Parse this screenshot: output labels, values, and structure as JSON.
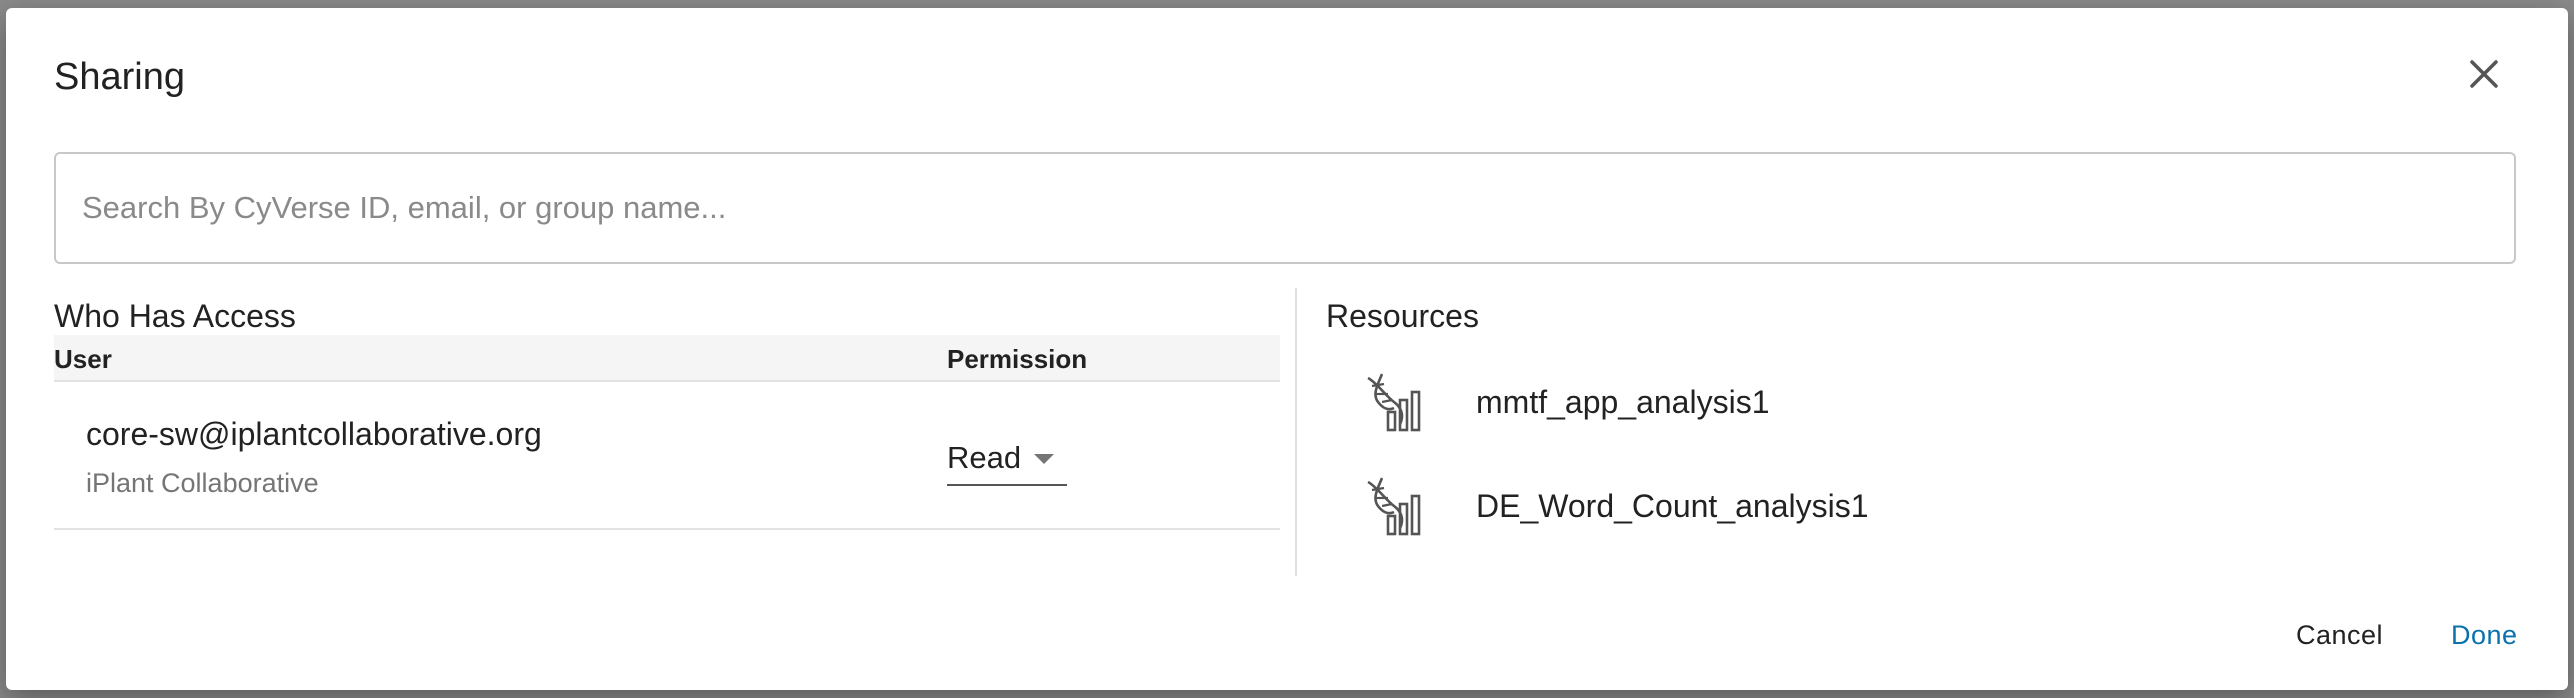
{
  "dialog": {
    "title": "Sharing",
    "close_icon": "close-icon"
  },
  "search": {
    "placeholder": "Search By CyVerse ID, email, or group name...",
    "value": ""
  },
  "access": {
    "heading": "Who Has Access",
    "columns": {
      "user": "User",
      "permission": "Permission"
    },
    "rows": [
      {
        "user": "core-sw@iplantcollaborative.org",
        "organization": "iPlant Collaborative",
        "permission": "Read"
      }
    ]
  },
  "resources": {
    "heading": "Resources",
    "icon": "analysis-icon",
    "items": [
      {
        "name": "mmtf_app_analysis1"
      },
      {
        "name": "DE_Word_Count_analysis1"
      }
    ]
  },
  "footer": {
    "cancel_label": "Cancel",
    "done_label": "Done"
  },
  "colors": {
    "accent": "#0971ab",
    "overlay": "#8a8a8a",
    "muted_text": "#757575"
  }
}
